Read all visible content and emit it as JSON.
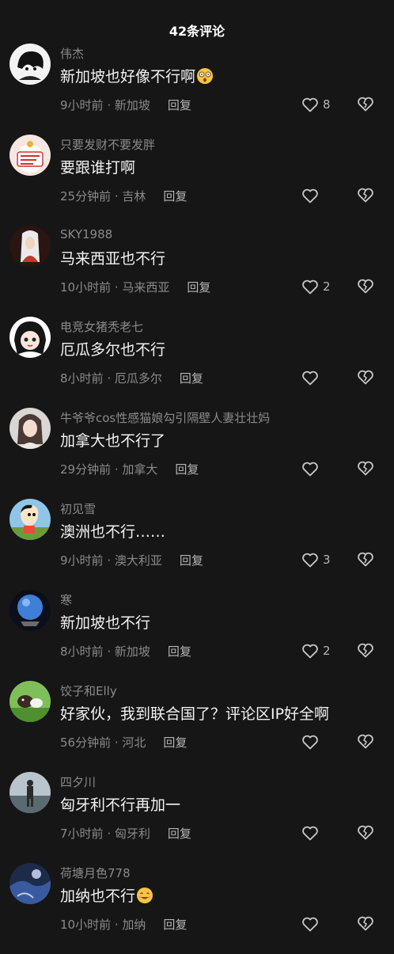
{
  "header": {
    "title": "42条评论"
  },
  "labels": {
    "reply": "回复"
  },
  "colors": {
    "background": "#161616",
    "muted": "#8a8a8a",
    "text": "#f2f2f2"
  },
  "comments": [
    {
      "name": "伟杰",
      "text": "新加坡也好像不行啊",
      "emoji": "astonished",
      "time": "9小时前",
      "location": "新加坡",
      "likes": "8"
    },
    {
      "name": "只要发财不要发胖",
      "text": "要跟谁打啊",
      "time": "25分钟前",
      "location": "吉林",
      "likes": ""
    },
    {
      "name": "SKY1988",
      "text": "马来西亚也不行",
      "time": "10小时前",
      "location": "马来西亚",
      "likes": "2"
    },
    {
      "name": "电竞女猪秃老七",
      "text": "厄瓜多尔也不行",
      "time": "8小时前",
      "location": "厄瓜多尔",
      "likes": ""
    },
    {
      "name": "牛爷爷cos性感猫娘勾引隔壁人妻壮壮妈",
      "text": "加拿大也不行了",
      "time": "29分钟前",
      "location": "加拿大",
      "likes": ""
    },
    {
      "name": "初见雪",
      "text": "澳洲也不行……",
      "time": "9小时前",
      "location": "澳大利亚",
      "likes": "3"
    },
    {
      "name": "寒",
      "text": "新加坡也不行",
      "time": "8小时前",
      "location": "新加坡",
      "likes": "2"
    },
    {
      "name": "饺子和Elly",
      "text": "好家伙，我到联合国了？评论区IP好全啊",
      "time": "56分钟前",
      "location": "河北",
      "likes": ""
    },
    {
      "name": "四夕川",
      "text": "匈牙利不行再加一",
      "time": "7小时前",
      "location": "匈牙利",
      "likes": ""
    },
    {
      "name": "荷塘月色778",
      "text": "加纳也不行",
      "emoji": "smile",
      "time": "10小时前",
      "location": "加纳",
      "likes": ""
    }
  ]
}
